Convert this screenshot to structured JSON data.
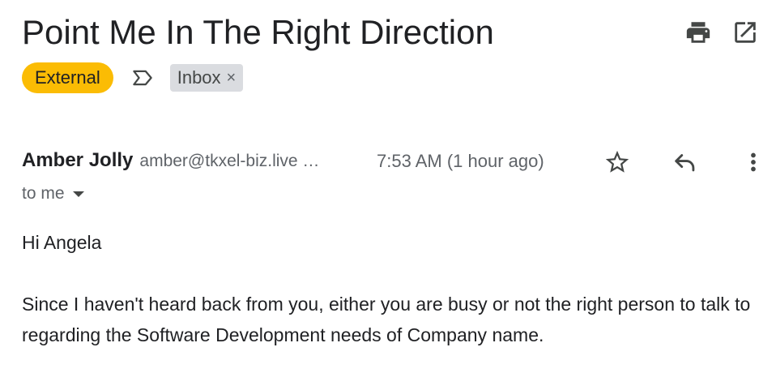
{
  "email": {
    "subject": "Point Me In The Right Direction",
    "labels": {
      "external": "External",
      "inbox": "Inbox",
      "inbox_remove": "×"
    },
    "header_icons": [
      "print-icon",
      "open-in-new-window-icon"
    ],
    "sender": {
      "name": "Amber Jolly",
      "email": "amber@tkxel-biz.live …"
    },
    "timestamp": "7:53 AM (1 hour ago)",
    "row_icons": [
      "star-icon",
      "reply-icon",
      "more-vert-icon"
    ],
    "recipients": "to me",
    "body": {
      "greeting": "Hi Angela",
      "paragraph": "Since I haven't heard back from you, either you are busy or not the right person to talk to regarding the Software Development needs of Company name."
    }
  },
  "colors": {
    "external_label_bg": "#fbbc04",
    "inbox_label_bg": "#dadce0",
    "icon_gray": "#444746",
    "text_primary": "#202124",
    "text_secondary": "#5f6368"
  }
}
